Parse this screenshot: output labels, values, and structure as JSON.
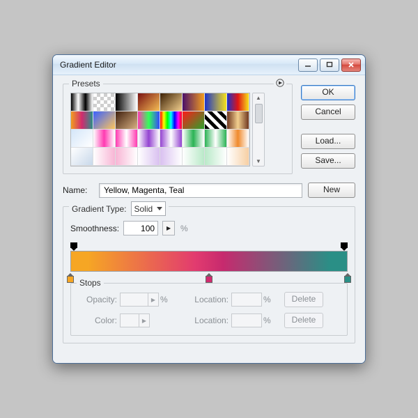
{
  "window": {
    "title": "Gradient Editor"
  },
  "buttons": {
    "ok": "OK",
    "cancel": "Cancel",
    "load": "Load...",
    "save": "Save...",
    "new": "New",
    "delete1": "Delete",
    "delete2": "Delete"
  },
  "labels": {
    "presets": "Presets",
    "name": "Name:",
    "gradient_type": "Gradient Type:",
    "smoothness": "Smoothness:",
    "stops": "Stops",
    "opacity": "Opacity:",
    "location1": "Location:",
    "color": "Color:",
    "location2": "Location:"
  },
  "values": {
    "name": "Yellow, Magenta, Teal",
    "gradient_type": "Solid",
    "smoothness": "100",
    "opacity": "",
    "location1": "",
    "location2": ""
  },
  "gradient": {
    "opacity_stops": [
      0,
      100
    ],
    "color_stops": [
      {
        "pos": 0,
        "color": "#f6a624"
      },
      {
        "pos": 50,
        "color": "#d12b6f"
      },
      {
        "pos": 100,
        "color": "#2a8f86"
      }
    ]
  },
  "presets": [
    "linear-gradient(90deg,#000,#fff,#000,#fff)",
    "repeating-conic-gradient(#cfcfcf 0 25%,#fff 0 50%) 0 0/10px 10px",
    "linear-gradient(90deg,#000,#fff)",
    "linear-gradient(135deg,#7a1212,#f5be55)",
    "linear-gradient(135deg,#3c2004,#f2cf8e)",
    "linear-gradient(90deg,#4a0f69,#f29d1f)",
    "linear-gradient(90deg,#1b33c9,#f7e11b)",
    "linear-gradient(90deg,#1b33c9,#e11414,#f7e11b)",
    "linear-gradient(90deg,#f29d1f,#d12b6f,#2a8f86)",
    "linear-gradient(135deg,#3961ff,#ffc55b)",
    "linear-gradient(135deg,#40200e,#d8b083)",
    "linear-gradient(90deg,#ff3ab1,#32ff59,#3646ff)",
    "linear-gradient(90deg,#ff0000,#ffff00,#00ff00,#00ffff,#0000ff,#ff00ff,#ff0000)",
    "linear-gradient(135deg,#ff1a1a,#29a329)",
    "repeating-linear-gradient(45deg,#000 0 5px,#fff 5px 10px)",
    "linear-gradient(90deg,#6f3720,#f2cf8e,#6f3720)",
    "linear-gradient(135deg,#d4e6f9,#ffffff)",
    "linear-gradient(90deg,#fff,#ff3ab1,#fff)",
    "linear-gradient(90deg,#ff3ab1,#fff,#ff3ab1)",
    "linear-gradient(90deg,#fff,#9444d1,#fff)",
    "linear-gradient(90deg,#9444d1,#fff,#9444d1)",
    "linear-gradient(90deg,#fff,#2bb354,#fff)",
    "linear-gradient(90deg,#2bb354,#fff,#2bb354)",
    "linear-gradient(90deg,#fff,#f08a2c,#fff)",
    "linear-gradient(135deg,#ffffff,#c8d8ea)",
    "linear-gradient(90deg,#ffffff,#f8b5d5)",
    "linear-gradient(90deg,#f8b5d5,#ffffff)",
    "linear-gradient(90deg,#ffffff,#d9c0f0)",
    "linear-gradient(90deg,#d9c0f0,#ffffff)",
    "linear-gradient(90deg,#fff,#b9e9c8)",
    "linear-gradient(90deg,#b9e9c8,#fff)",
    "linear-gradient(90deg,#fff,#f7cfa3)"
  ]
}
